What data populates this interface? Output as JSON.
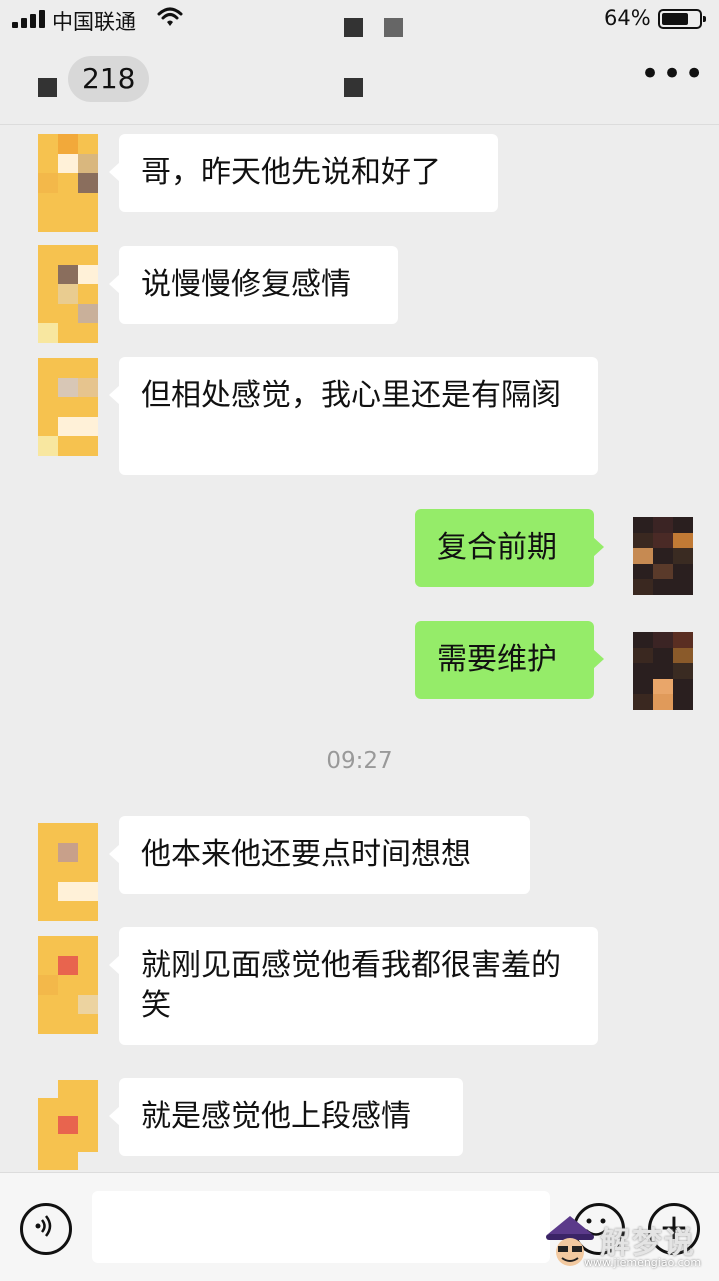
{
  "status_bar": {
    "carrier": "中国联通",
    "battery_percent": "64%",
    "battery_level": 0.64
  },
  "header": {
    "back_label": "218",
    "more_label": "•••"
  },
  "messages": [
    {
      "side": "left",
      "text": "哥，昨天他先说和好了"
    },
    {
      "side": "left",
      "text": "说慢慢修复感情"
    },
    {
      "side": "left",
      "text": "但相处感觉，我心里还是有隔阂"
    },
    {
      "side": "right",
      "text": "复合前期"
    },
    {
      "side": "right",
      "text": "需要维护"
    },
    {
      "side": "left",
      "text": "他本来他还要点时间想想"
    },
    {
      "side": "left",
      "text": "就刚见面感觉他看我都很害羞的笑"
    },
    {
      "side": "left",
      "text": "就是感觉他上段感情"
    }
  ],
  "timestamp": "09:27",
  "input_bar": {
    "plus_label": "+"
  },
  "watermark": {
    "text": "解梦说",
    "url": "www.jiemengiao.com"
  },
  "colors": {
    "background": "#ededed",
    "bubble_left": "#ffffff",
    "bubble_right": "#95ec69",
    "timestamp": "#999999"
  },
  "icons": [
    "signal-icon",
    "wifi-icon",
    "battery-icon",
    "more-icon",
    "voice-icon",
    "emoji-icon",
    "plus-icon"
  ]
}
